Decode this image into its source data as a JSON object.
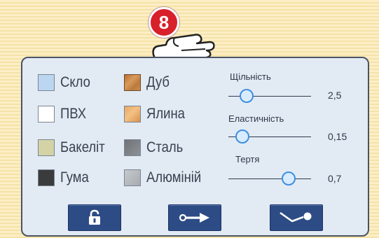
{
  "step_badge": "8",
  "materials": [
    {
      "label": "Скло",
      "swatch": "glass",
      "color": "#bcd6f1"
    },
    {
      "label": "ПВХ",
      "swatch": "pvc",
      "color": "#ffffff"
    },
    {
      "label": "Бакеліт",
      "swatch": "bakelite",
      "color": "#d4d3a6"
    },
    {
      "label": "Гума",
      "swatch": "rubber",
      "color": "#3a3b3c"
    },
    {
      "label": "Дуб",
      "swatch": "oak",
      "color": "#c9833f"
    },
    {
      "label": "Ялина",
      "swatch": "spruce",
      "color": "#e6a35c"
    },
    {
      "label": "Сталь",
      "swatch": "steel",
      "color": "#7e8185"
    },
    {
      "label": "Алюміній",
      "swatch": "aluminium",
      "color": "#b9bdc1"
    }
  ],
  "sliders": {
    "density": {
      "label": "Щільність",
      "value": "2,5",
      "level": 0.22
    },
    "elasticity": {
      "label": "Еластичність",
      "value": "0,15",
      "level": 0.17
    },
    "friction": {
      "label": "Тертя",
      "value": "0,7",
      "level": 0.73
    }
  },
  "buttons": {
    "lock": {
      "icon": "unlock-icon"
    },
    "pin": {
      "icon": "arrow-pin-icon"
    },
    "seesaw": {
      "icon": "seesaw-icon"
    }
  },
  "colors": {
    "panel_bg": "#e2eaf4",
    "button_bg": "#2d4c85",
    "badge_red": "#d8202b",
    "knob_border": "#3d8fe0"
  }
}
